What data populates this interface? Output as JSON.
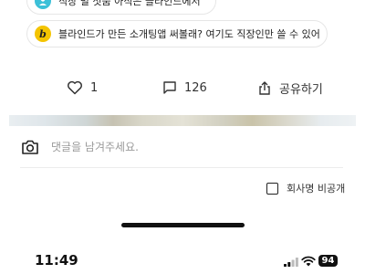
{
  "banners": [
    {
      "text": "직장 별 첫줌 아직은 블라인드에서",
      "icon": "blind-blue-logo-icon",
      "color": "#3cc0d8"
    },
    {
      "text": "블라인드가 만든 소개팅앱 써볼래? 여기도 직장인만 쓸 수 있어",
      "icon": "b-yellow-logo-icon",
      "badge_letter": "b",
      "color": "#f4c400"
    }
  ],
  "actions": {
    "like_count": "1",
    "comment_count": "126",
    "share_label": "공유하기"
  },
  "comment": {
    "placeholder": "댓글을 남겨주세요.",
    "value": ""
  },
  "anonymous": {
    "label": "회사명 비공개",
    "checked": false
  },
  "status_bar": {
    "time": "11:49",
    "battery": "94"
  }
}
